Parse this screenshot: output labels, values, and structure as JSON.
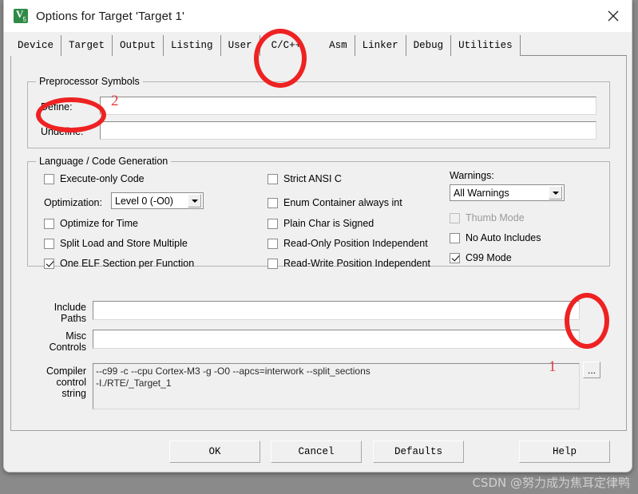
{
  "window": {
    "title": "Options for Target 'Target 1'",
    "icon": "keil-uvision-icon",
    "close_icon": "close-icon"
  },
  "tabs": [
    {
      "label": "Device",
      "active": false
    },
    {
      "label": "Target",
      "active": false
    },
    {
      "label": "Output",
      "active": false
    },
    {
      "label": "Listing",
      "active": false
    },
    {
      "label": "User",
      "active": false
    },
    {
      "label": "C/C++",
      "active": true
    },
    {
      "label": "Asm",
      "active": false
    },
    {
      "label": "Linker",
      "active": false
    },
    {
      "label": "Debug",
      "active": false
    },
    {
      "label": "Utilities",
      "active": false
    }
  ],
  "preprocessor": {
    "legend": "Preprocessor Symbols",
    "define_label": "Define:",
    "define_value": "",
    "undefine_label": "Undefine:",
    "undefine_value": ""
  },
  "language": {
    "legend": "Language / Code Generation",
    "col_left": [
      {
        "label": "Execute-only Code",
        "checked": false,
        "disabled": false
      },
      {
        "label": "Optimize for Time",
        "checked": false,
        "disabled": false
      },
      {
        "label": "Split Load and Store Multiple",
        "checked": false,
        "disabled": false
      },
      {
        "label": "One ELF Section per Function",
        "checked": true,
        "disabled": false
      }
    ],
    "optimization_label": "Optimization:",
    "optimization_value": "Level 0 (-O0)",
    "col_mid": [
      {
        "label": "Strict ANSI C",
        "checked": false,
        "disabled": false
      },
      {
        "label": "Enum Container always int",
        "checked": false,
        "disabled": false
      },
      {
        "label": "Plain Char is Signed",
        "checked": false,
        "disabled": false
      },
      {
        "label": "Read-Only Position Independent",
        "checked": false,
        "disabled": false
      },
      {
        "label": "Read-Write Position Independent",
        "checked": false,
        "disabled": false
      }
    ],
    "warnings_label": "Warnings:",
    "warnings_value": "All Warnings",
    "col_right": [
      {
        "label": "Thumb Mode",
        "checked": false,
        "disabled": true
      },
      {
        "label": "No Auto Includes",
        "checked": false,
        "disabled": false
      },
      {
        "label": "C99 Mode",
        "checked": true,
        "disabled": false
      }
    ]
  },
  "paths": {
    "include_label": "Include\nPaths",
    "include_value": "",
    "misc_label": "Misc\nControls",
    "misc_value": "",
    "compiler_label": "Compiler\ncontrol\nstring",
    "compiler_value": "--c99 -c --cpu Cortex-M3 -g -O0 --apcs=interwork --split_sections\n-I./RTE/_Target_1",
    "browse_label": "..."
  },
  "buttons": {
    "ok": "OK",
    "cancel": "Cancel",
    "defaults": "Defaults",
    "help": "Help"
  },
  "annotations": {
    "marker_1": "1",
    "marker_2": "2"
  },
  "watermark": "CSDN @努力成为焦耳定律鸭"
}
